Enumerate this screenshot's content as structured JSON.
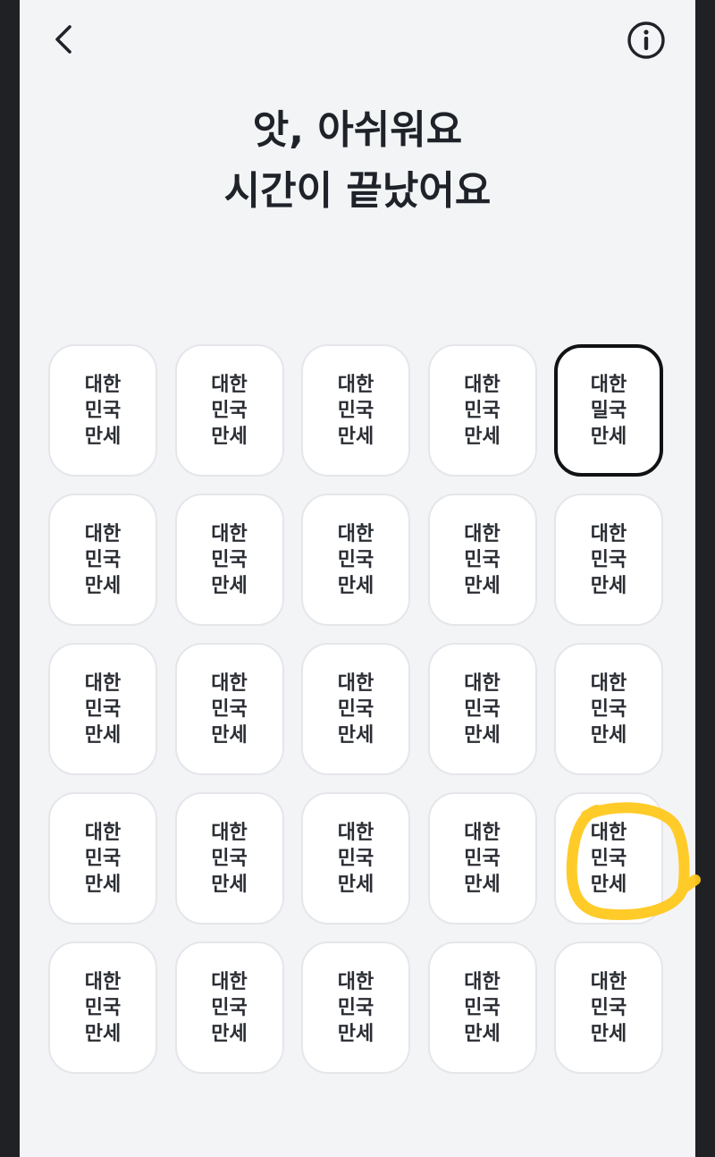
{
  "header": {
    "back_icon": "chevron-left-icon",
    "info_icon": "info-circle-icon"
  },
  "title": {
    "line1": "앗, 아쉬워요",
    "line2": "시간이 끝났어요"
  },
  "grid": {
    "columns": 5,
    "rows": 5,
    "default_label": [
      "대한",
      "민국",
      "만세"
    ],
    "tiles": [
      {
        "lines": [
          "대한",
          "민국",
          "만세"
        ]
      },
      {
        "lines": [
          "대한",
          "민국",
          "만세"
        ]
      },
      {
        "lines": [
          "대한",
          "민국",
          "만세"
        ]
      },
      {
        "lines": [
          "대한",
          "민국",
          "만세"
        ]
      },
      {
        "lines": [
          "대한",
          "밀국",
          "만세"
        ],
        "state": "selected"
      },
      {
        "lines": [
          "대한",
          "민국",
          "만세"
        ]
      },
      {
        "lines": [
          "대한",
          "민국",
          "만세"
        ]
      },
      {
        "lines": [
          "대한",
          "민국",
          "만세"
        ]
      },
      {
        "lines": [
          "대한",
          "민국",
          "만세"
        ]
      },
      {
        "lines": [
          "대한",
          "민국",
          "만세"
        ]
      },
      {
        "lines": [
          "대한",
          "민국",
          "만세"
        ]
      },
      {
        "lines": [
          "대한",
          "민국",
          "만세"
        ]
      },
      {
        "lines": [
          "대한",
          "민국",
          "만세"
        ]
      },
      {
        "lines": [
          "대한",
          "민국",
          "만세"
        ]
      },
      {
        "lines": [
          "대한",
          "민국",
          "만세"
        ]
      },
      {
        "lines": [
          "대한",
          "민국",
          "만세"
        ]
      },
      {
        "lines": [
          "대한",
          "민국",
          "만세"
        ]
      },
      {
        "lines": [
          "대한",
          "민국",
          "만세"
        ]
      },
      {
        "lines": [
          "대한",
          "민국",
          "만세"
        ]
      },
      {
        "lines": [
          "대한",
          "민국",
          "만세"
        ],
        "state": "circled-answer"
      },
      {
        "lines": [
          "대한",
          "민국",
          "만세"
        ]
      },
      {
        "lines": [
          "대한",
          "민국",
          "만세"
        ]
      },
      {
        "lines": [
          "대한",
          "민국",
          "만세"
        ]
      },
      {
        "lines": [
          "대한",
          "민국",
          "만세"
        ]
      },
      {
        "lines": [
          "대한",
          "민국",
          "만세"
        ]
      }
    ]
  },
  "colors": {
    "background": "#f3f4f6",
    "tile": "#ffffff",
    "text": "#1f2329",
    "selected_border": "#111214",
    "highlight_marker": "#ffc81e"
  }
}
